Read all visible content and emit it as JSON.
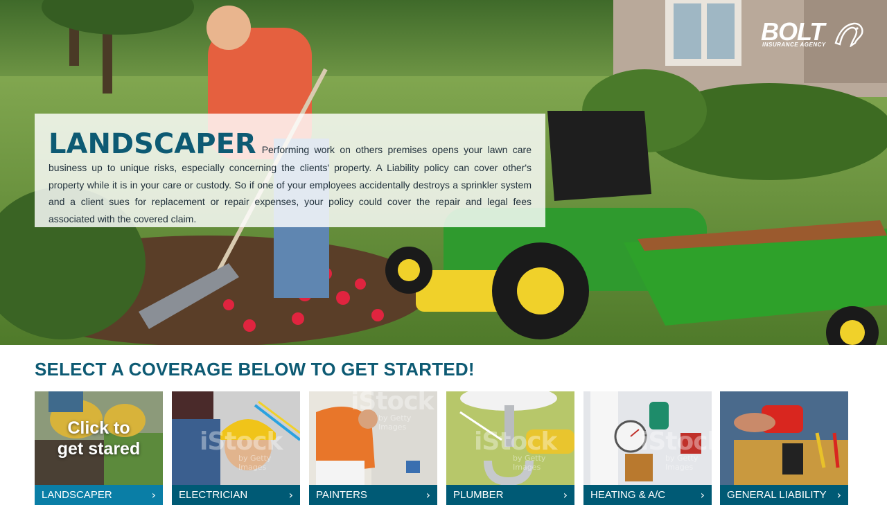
{
  "brand": {
    "name": "BOLT",
    "tagline": "INSURANCE AGENCY",
    "logo_icon": "horse-head-icon"
  },
  "hero": {
    "title": "LANDSCAPER",
    "description": "Performing work on others premises opens your lawn care business up to unique risks, especially concerning the clients' property. A Liability policy can cover other's property while it is in your care or custody. So if one of your employees accidentally destroys a sprinkler system and a client sues for replacement or repair expenses, your policy could cover the repair and legal fees associated with the covered claim."
  },
  "selection": {
    "heading": "SELECT A COVERAGE BELOW TO GET STARTED!",
    "cta_overlay": "Click to get stared",
    "chevron": "›",
    "watermark": "iStock",
    "watermark_sub": "by Getty Images",
    "cards": [
      {
        "label": "LANDSCAPER",
        "icon": "landscaper-photo",
        "active": true
      },
      {
        "label": "ELECTRICIAN",
        "icon": "electrician-photo",
        "active": false
      },
      {
        "label": "PAINTERS",
        "icon": "painter-photo",
        "active": false
      },
      {
        "label": "PLUMBER",
        "icon": "plumber-photo",
        "active": false
      },
      {
        "label": "HEATING & A/C",
        "icon": "hvac-photo",
        "active": false
      },
      {
        "label": "GENERAL LIABILITY",
        "icon": "toolbelt-photo",
        "active": false
      }
    ]
  },
  "colors": {
    "brand_teal": "#0d5a73",
    "bar_default": "#005a75",
    "bar_active": "#0a7ea6"
  }
}
